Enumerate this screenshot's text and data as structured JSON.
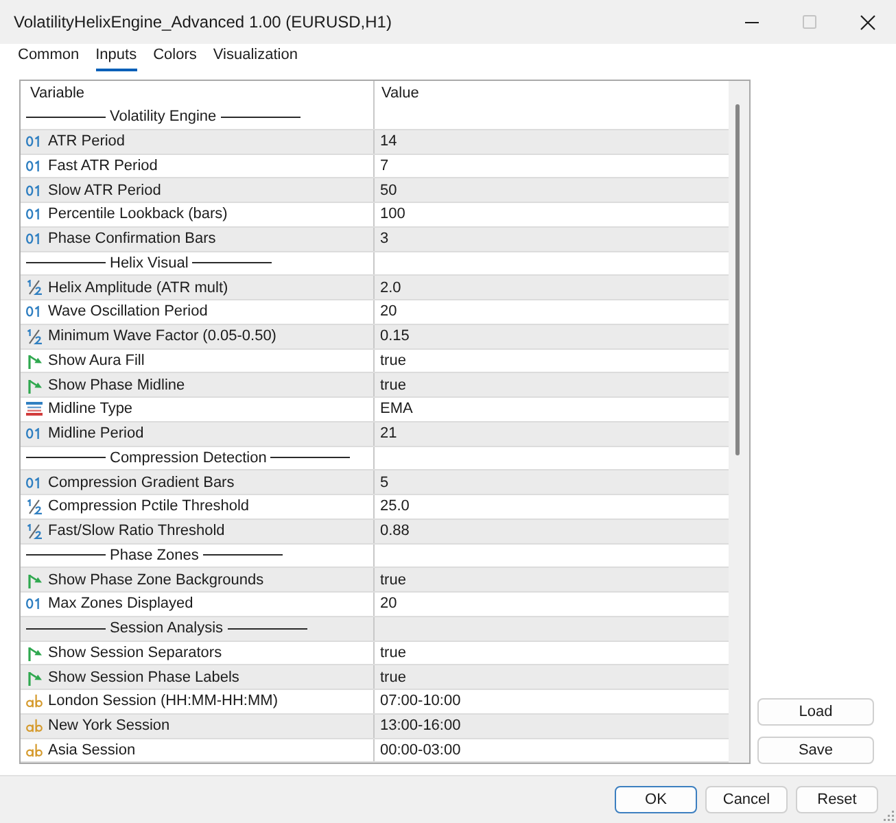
{
  "window": {
    "title": "VolatilityHelixEngine_Advanced 1.00 (EURUSD,H1)",
    "controls": [
      {
        "kind": "minimize",
        "disabled": false
      },
      {
        "kind": "maximize",
        "disabled": true
      },
      {
        "kind": "close",
        "disabled": false
      }
    ]
  },
  "tabs": [
    {
      "label": "Common",
      "selected": false
    },
    {
      "label": "Inputs",
      "selected": true
    },
    {
      "label": "Colors",
      "selected": false
    },
    {
      "label": "Visualization",
      "selected": false
    }
  ],
  "table": {
    "columns": [
      "Variable",
      "Value"
    ],
    "rows": [
      {
        "kind": "separator",
        "label": "Volatility Engine"
      },
      {
        "kind": "int",
        "variable": "ATR Period",
        "value": "14"
      },
      {
        "kind": "int",
        "variable": "Fast ATR Period",
        "value": "7"
      },
      {
        "kind": "int",
        "variable": "Slow ATR Period",
        "value": "50"
      },
      {
        "kind": "int",
        "variable": "Percentile Lookback (bars)",
        "value": "100"
      },
      {
        "kind": "int",
        "variable": "Phase Confirmation Bars",
        "value": "3"
      },
      {
        "kind": "separator",
        "label": "Helix Visual"
      },
      {
        "kind": "double",
        "variable": "Helix Amplitude (ATR mult)",
        "value": "2.0"
      },
      {
        "kind": "int",
        "variable": "Wave Oscillation Period",
        "value": "20"
      },
      {
        "kind": "double",
        "variable": "Minimum Wave Factor (0.05-0.50)",
        "value": "0.15"
      },
      {
        "kind": "bool",
        "variable": "Show Aura Fill",
        "value": "true"
      },
      {
        "kind": "bool",
        "variable": "Show Phase Midline",
        "value": "true"
      },
      {
        "kind": "enum",
        "variable": "Midline Type",
        "value": "EMA"
      },
      {
        "kind": "int",
        "variable": "Midline Period",
        "value": "21"
      },
      {
        "kind": "separator",
        "label": "Compression Detection"
      },
      {
        "kind": "int",
        "variable": "Compression Gradient Bars",
        "value": "5"
      },
      {
        "kind": "double",
        "variable": "Compression Pctile Threshold",
        "value": "25.0"
      },
      {
        "kind": "double",
        "variable": "Fast/Slow Ratio Threshold",
        "value": "0.88"
      },
      {
        "kind": "separator",
        "label": "Phase Zones"
      },
      {
        "kind": "bool",
        "variable": "Show Phase Zone Backgrounds",
        "value": "true"
      },
      {
        "kind": "int",
        "variable": "Max Zones Displayed",
        "value": "20"
      },
      {
        "kind": "separator",
        "label": "Session Analysis"
      },
      {
        "kind": "bool",
        "variable": "Show Session Separators",
        "value": "true"
      },
      {
        "kind": "bool",
        "variable": "Show Session Phase Labels",
        "value": "true"
      },
      {
        "kind": "string",
        "variable": "London Session (HH:MM-HH:MM)",
        "value": "07:00-10:00"
      },
      {
        "kind": "string",
        "variable": "New York Session",
        "value": "13:00-16:00"
      },
      {
        "kind": "string",
        "variable": "Asia Session",
        "value": "00:00-03:00"
      }
    ]
  },
  "side_buttons": [
    "Load",
    "Save"
  ],
  "buttons": [
    {
      "label": "OK",
      "default": true
    },
    {
      "label": "Cancel",
      "default": false
    },
    {
      "label": "Reset",
      "default": false
    }
  ]
}
